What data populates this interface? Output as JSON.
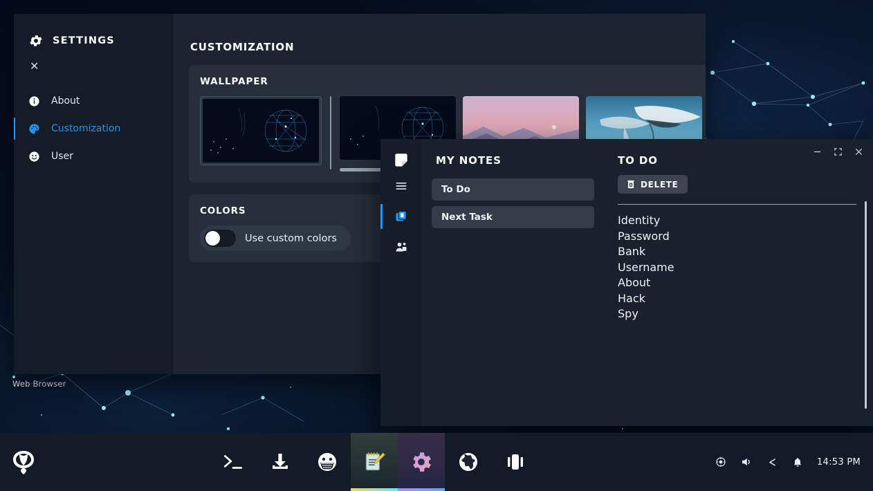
{
  "desktop": {
    "icon_label": "Web Browser",
    "wallpaper_name": "network-constellation-wallpaper"
  },
  "settings_window": {
    "sidebar": {
      "title": "SETTINGS",
      "gear_icon": "gear-icon",
      "close_icon": "close-icon",
      "items": [
        {
          "label": "About",
          "icon": "info-icon",
          "active": false
        },
        {
          "label": "Customization",
          "icon": "palette-icon",
          "active": true
        },
        {
          "label": "User",
          "icon": "user-face-icon",
          "active": false
        }
      ]
    },
    "controls": {
      "minimize": "minimize-icon",
      "maximize": "maximize-icon",
      "close": "close-icon"
    },
    "page_title": "CUSTOMIZATION",
    "wallpaper": {
      "title": "WALLPAPER",
      "selected_index": 0,
      "thumbnails": [
        {
          "name": "network-globe-dark",
          "colors": [
            "#050b1b",
            "#0b2a4a",
            "#2a7fb8"
          ]
        },
        {
          "name": "network-globe-dark",
          "colors": [
            "#050b1b",
            "#0b2a4a",
            "#2a7fb8"
          ]
        },
        {
          "name": "purple-mountains-dusk",
          "colors": [
            "#e9b7c8",
            "#7d7fa8",
            "#3b4060"
          ]
        },
        {
          "name": "whale-underwater",
          "colors": [
            "#7fc4e0",
            "#2f6f96",
            "#d7e6ee"
          ]
        },
        {
          "name": "rainy-city-street",
          "colors": [
            "#8c9089",
            "#55594f",
            "#c7cbc2"
          ]
        }
      ]
    },
    "colors": {
      "title": "COLORS",
      "toggle_label": "Use custom colors",
      "toggle_on": false
    },
    "accent_color": "#2196f3"
  },
  "notes_window": {
    "rail": {
      "logo_icon": "sticky-note-icon",
      "buttons": [
        {
          "icon": "hamburger-menu-icon",
          "active": false
        },
        {
          "icon": "notes-copy-icon",
          "active": true
        },
        {
          "icon": "share-people-icon",
          "active": false
        }
      ]
    },
    "list_pane": {
      "title": "MY NOTES",
      "notes": [
        "To Do",
        "Next Task"
      ]
    },
    "todo_pane": {
      "title": "TO DO",
      "delete_label": "DELETE",
      "delete_icon": "trash-icon",
      "items": [
        "Identity",
        "Password",
        "Bank",
        "Username",
        "About",
        "Hack",
        "Spy"
      ]
    },
    "controls": {
      "minimize": "minimize-icon",
      "maximize": "maximize-icon",
      "close": "close-icon"
    }
  },
  "taskbar": {
    "start_icon": "start-logo-icon",
    "apps": [
      {
        "name": "terminal",
        "icon": "terminal-prompt-icon",
        "running": false
      },
      {
        "name": "downloads",
        "icon": "download-arrow-icon",
        "running": false
      },
      {
        "name": "mask",
        "icon": "masked-face-icon",
        "running": false
      },
      {
        "name": "notes",
        "icon": "notepad-pencil-icon",
        "running": true
      },
      {
        "name": "settings",
        "icon": "gear-icon",
        "running": true
      },
      {
        "name": "browser",
        "icon": "globe-icon",
        "running": false
      },
      {
        "name": "panels",
        "icon": "split-panels-icon",
        "running": false
      }
    ],
    "tray": [
      {
        "name": "record",
        "icon": "record-circle-icon"
      },
      {
        "name": "volume",
        "icon": "speaker-icon"
      },
      {
        "name": "share",
        "icon": "share-icon"
      },
      {
        "name": "notifications",
        "icon": "bell-icon"
      }
    ],
    "clock": "14:53 PM"
  }
}
